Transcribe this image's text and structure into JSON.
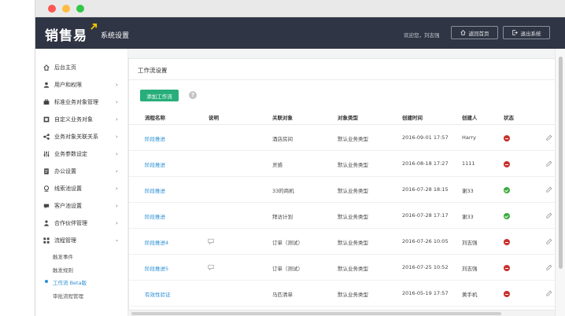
{
  "header": {
    "logo_text": "销售易",
    "title": "系统设置",
    "welcome": "欢迎您，刘志强",
    "home_button": "返回首页",
    "logout_button": "退出系统"
  },
  "sidebar": {
    "items": [
      {
        "label": "后台主页",
        "icon": "home-icon",
        "has_chevron": false
      },
      {
        "label": "用户和权限",
        "icon": "user-icon",
        "has_chevron": true
      },
      {
        "label": "标准业务对象管理",
        "icon": "briefcase-icon",
        "has_chevron": true
      },
      {
        "label": "自定义业务对象",
        "icon": "object-icon",
        "has_chevron": true
      },
      {
        "label": "业务对象关联关系",
        "icon": "relation-icon",
        "has_chevron": true
      },
      {
        "label": "业务参数设定",
        "icon": "sliders-icon",
        "has_chevron": true
      },
      {
        "label": "办公设置",
        "icon": "document-icon",
        "has_chevron": true
      },
      {
        "label": "线索池设置",
        "icon": "lead-icon",
        "has_chevron": true
      },
      {
        "label": "客户池设置",
        "icon": "customer-icon",
        "has_chevron": true
      },
      {
        "label": "合作伙伴管理",
        "icon": "partner-icon",
        "has_chevron": true
      },
      {
        "label": "流程管理",
        "icon": "flow-icon",
        "has_chevron": true,
        "expanded": true
      }
    ],
    "sub_items": [
      {
        "label": "触发事件",
        "active": false
      },
      {
        "label": "触发规则",
        "active": false
      },
      {
        "label": "工作流 Beta版",
        "active": true
      },
      {
        "label": "审批流程管理",
        "active": false
      }
    ]
  },
  "main": {
    "panel_title": "工作流设置",
    "add_button": "添加工作流",
    "help_icon": "?",
    "columns": [
      "流程名称",
      "说明",
      "关联对象",
      "对象类型",
      "创建时间",
      "创建人",
      "状态"
    ],
    "rows": [
      {
        "name": "阶段推进",
        "desc": false,
        "object": "酒店房间",
        "type": "默认业务类型",
        "created": "2016-09-01 17:57",
        "creator": "Harry",
        "status": "off"
      },
      {
        "name": "阶段推进",
        "desc": false,
        "object": "灵感",
        "type": "默认业务类型",
        "created": "2016-08-18 17:27",
        "creator": "1111",
        "status": "off"
      },
      {
        "name": "阶段推进",
        "desc": false,
        "object": "33的商机",
        "type": "默认业务类型",
        "created": "2016-07-28 18:15",
        "creator": "谢33",
        "status": "on"
      },
      {
        "name": "阶段推进",
        "desc": false,
        "object": "拜访计划",
        "type": "默认业务类型",
        "created": "2016-07-28 17:17",
        "creator": "谢33",
        "status": "on"
      },
      {
        "name": "阶段推进4",
        "desc": true,
        "object": "订单（测试）",
        "type": "默认业务类型",
        "created": "2016-07-26 10:05",
        "creator": "刘志强",
        "status": "off"
      },
      {
        "name": "阶段推进5",
        "desc": true,
        "object": "订单（测试）",
        "type": "默认业务类型",
        "created": "2016-07-25 10:52",
        "creator": "刘志强",
        "status": "off"
      },
      {
        "name": "有效性验证",
        "desc": false,
        "object": "马匹清单",
        "type": "默认业务类型",
        "created": "2016-05-19 17:57",
        "creator": "黄手机",
        "status": "off"
      }
    ]
  },
  "colors": {
    "header_bg": "#2f3544",
    "accent_green": "#27ae7a",
    "link_blue": "#2a8fd4",
    "status_off": "#c9302c",
    "status_on": "#3cab3c"
  }
}
